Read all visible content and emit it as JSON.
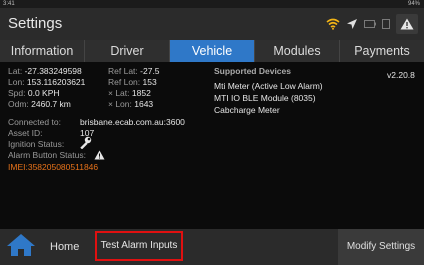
{
  "statusbar": {
    "time": "3:41",
    "right": "94%"
  },
  "app": {
    "title": "Settings"
  },
  "tabs": [
    {
      "label": "Information"
    },
    {
      "label": "Driver"
    },
    {
      "label": "Vehicle",
      "active": true
    },
    {
      "label": "Modules"
    },
    {
      "label": "Payments"
    }
  ],
  "gps": {
    "lat_label": "Lat:",
    "lat_value": "-27.383249598",
    "lon_label": "Lon:",
    "lon_value": "153.116203621",
    "spd_label": "Spd:",
    "spd_value": "0.0 KPH",
    "odm_label": "Odm:",
    "odm_value": "2460.7 km",
    "ref_lat_label": "Ref Lat:",
    "ref_lat_value": "-27.5",
    "ref_lon_label": "Ref Lon:",
    "ref_lon_value": "153",
    "xlat_label": "× Lat:",
    "xlat_value": "1852",
    "xlon_label": "× Lon:",
    "xlon_value": "1643"
  },
  "supported_devices": {
    "heading": "Supported Devices",
    "items": [
      "Mti Meter (Active Low Alarm)",
      "MTI IO BLE Module (8035)",
      "Cabcharge Meter"
    ],
    "version": "v2.20.8"
  },
  "connection": {
    "connected_label": "Connected to:",
    "connected_value": "brisbane.ecab.com.au:3600",
    "asset_label": "Asset ID:",
    "asset_value": "107",
    "ignition_label": "Ignition Status:",
    "alarm_label": "Alarm Button Status:",
    "imei_label": "IMEI:",
    "imei_value": "358205080511846"
  },
  "bottom": {
    "home_label": "Home",
    "test_alarm_label": "Test Alarm Inputs",
    "modify_label": "Modify Settings"
  },
  "colors": {
    "accent": "#2f78c8",
    "imei": "#e8731a",
    "highlight": "#e01010",
    "home_icon": "#2f78c8"
  },
  "icons": [
    "wifi-icon",
    "location-arrow-icon",
    "battery-icon",
    "warning-icon",
    "wrench-icon",
    "home-icon"
  ]
}
